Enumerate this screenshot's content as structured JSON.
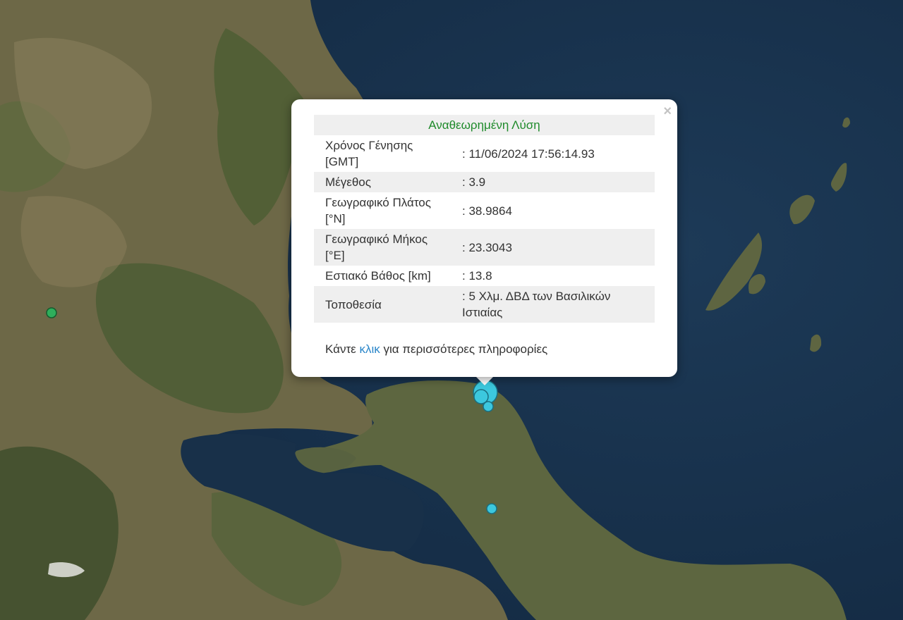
{
  "popup": {
    "close_icon": "×",
    "header": "Αναθεωρημένη Λύση",
    "rows": [
      {
        "label": "Χρόνος Γένησης [GMT]",
        "value": ": 11/06/2024 17:56:14.93"
      },
      {
        "label": "Μέγεθος",
        "value": ": 3.9"
      },
      {
        "label": "Γεωγραφικό Πλάτος [°N]",
        "value": ": 38.9864"
      },
      {
        "label": "Γεωγραφικό Μήκος [°E]",
        "value": ": 23.3043"
      },
      {
        "label": "Εστιακό Βάθος [km]",
        "value": ": 13.8"
      },
      {
        "label": "Τοποθεσία",
        "value": ": 5 Χλμ. ΔΒΔ των Βασιλικών Ιστιαίας"
      }
    ],
    "more_prefix": "Κάντε ",
    "more_link": "κλικ",
    "more_suffix": " για περισσότερες πληροφορίες"
  },
  "colors": {
    "sea": "#1b3550",
    "land": "#6e6a48",
    "marker_cyan": "#3cc8de",
    "marker_green": "#2fae5c",
    "header_green": "#1e8a2a",
    "link_blue": "#2a86c9"
  }
}
